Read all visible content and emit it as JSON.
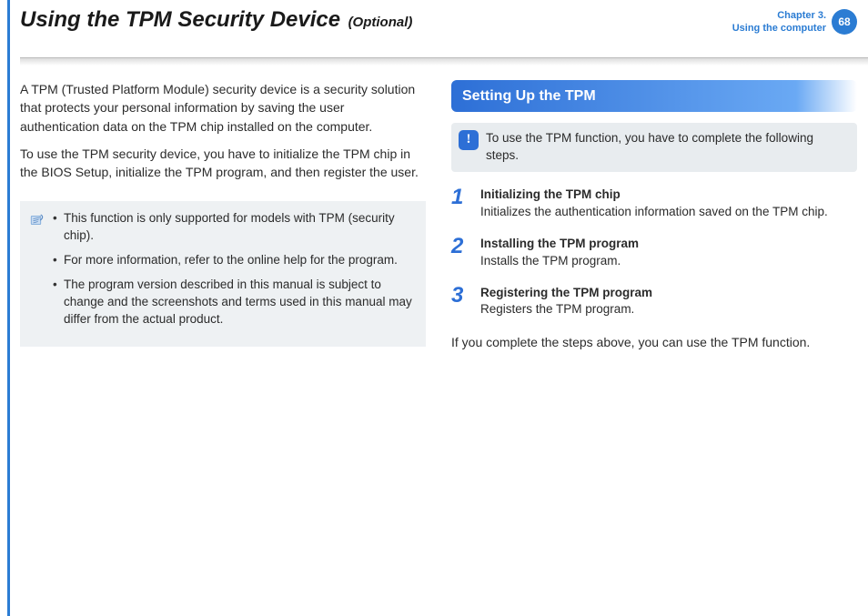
{
  "header": {
    "title": "Using the TPM Security Device",
    "suffix": "(Optional)",
    "chapter_line1": "Chapter 3.",
    "chapter_line2": "Using the computer",
    "page": "68"
  },
  "left": {
    "p1": "A TPM (Trusted Platform Module) security device is a security solution that protects your personal information by saving the user authentication data on the TPM chip installed on the computer.",
    "p2": "To use the TPM security device, you have to initialize the TPM chip in the BIOS Setup, initialize the TPM program, and then register the user.",
    "notes": [
      "This function is only supported for models with TPM (security chip).",
      "For more information, refer to the online help for the program.",
      "The program version described in this manual is subject to change and the screenshots and terms used in this manual may differ from the actual product."
    ]
  },
  "right": {
    "section": "Setting Up the TPM",
    "callout": "To use the TPM function, you have to complete the following steps.",
    "steps": [
      {
        "num": "1",
        "title": "Initializing the TPM chip",
        "desc": "Initializes the authentication information saved on the TPM chip."
      },
      {
        "num": "2",
        "title": "Installing the TPM program",
        "desc": "Installs the TPM program."
      },
      {
        "num": "3",
        "title": "Registering the TPM program",
        "desc": "Registers the TPM program."
      }
    ],
    "closing": "If you complete the steps above, you can use the TPM function."
  }
}
